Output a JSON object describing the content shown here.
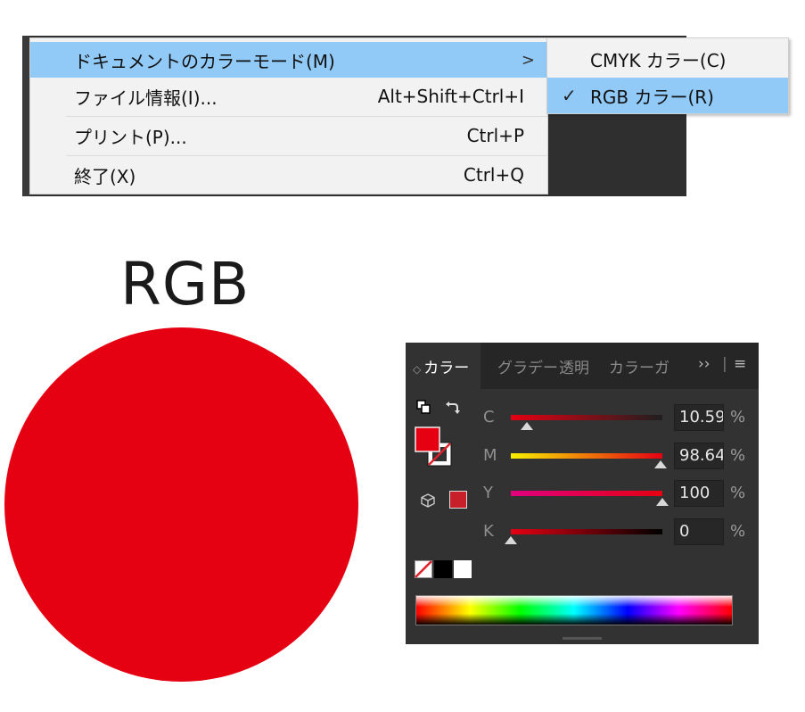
{
  "menu": {
    "items": [
      {
        "label": "ドキュメントのカラーモード(M)",
        "shortcut": "",
        "has_submenu": true,
        "highlighted": true
      },
      {
        "label": "ファイル情報(I)...",
        "shortcut": "Alt+Shift+Ctrl+I",
        "has_submenu": false,
        "highlighted": false
      },
      {
        "label": "プリント(P)...",
        "shortcut": "Ctrl+P",
        "has_submenu": false,
        "highlighted": false
      },
      {
        "label": "終了(X)",
        "shortcut": "Ctrl+Q",
        "has_submenu": false,
        "highlighted": false
      }
    ],
    "submenu_arrow": ">",
    "submenu": [
      {
        "label": "CMYK カラー(C)",
        "checked": false,
        "highlighted": false
      },
      {
        "label": "RGB カラー(R)",
        "checked": true,
        "highlighted": true
      }
    ],
    "check_glyph": "✓",
    "highlight_color": "#91c9f7"
  },
  "heading": {
    "text": "RGB"
  },
  "swatch": {
    "color": "#e50012"
  },
  "color_panel": {
    "tabs": [
      {
        "label": "カラー",
        "active": true
      },
      {
        "label": "グラデー",
        "active": false
      },
      {
        "label": "透明",
        "active": false
      },
      {
        "label": "カラーガ",
        "active": false
      }
    ],
    "tab_prefix_glyph": "◇",
    "overflow_glyph": "››",
    "menu_glyph": "≡",
    "channels": [
      {
        "letter": "C",
        "value": "10.59",
        "level": 0.106,
        "unit": "%"
      },
      {
        "letter": "M",
        "value": "98.64",
        "level": 0.986,
        "unit": "%"
      },
      {
        "letter": "Y",
        "value": "100",
        "level": 1.0,
        "unit": "%"
      },
      {
        "letter": "K",
        "value": "0",
        "level": 0.0,
        "unit": "%"
      }
    ],
    "fill_color": "#e50012",
    "gamut_color": "#c8202a",
    "icons": [
      "default-fill-stroke-icon",
      "swap-fill-stroke-icon",
      "out-of-web-gamut-icon",
      "none-swatch-icon",
      "black-swatch-icon",
      "white-swatch-icon"
    ]
  }
}
